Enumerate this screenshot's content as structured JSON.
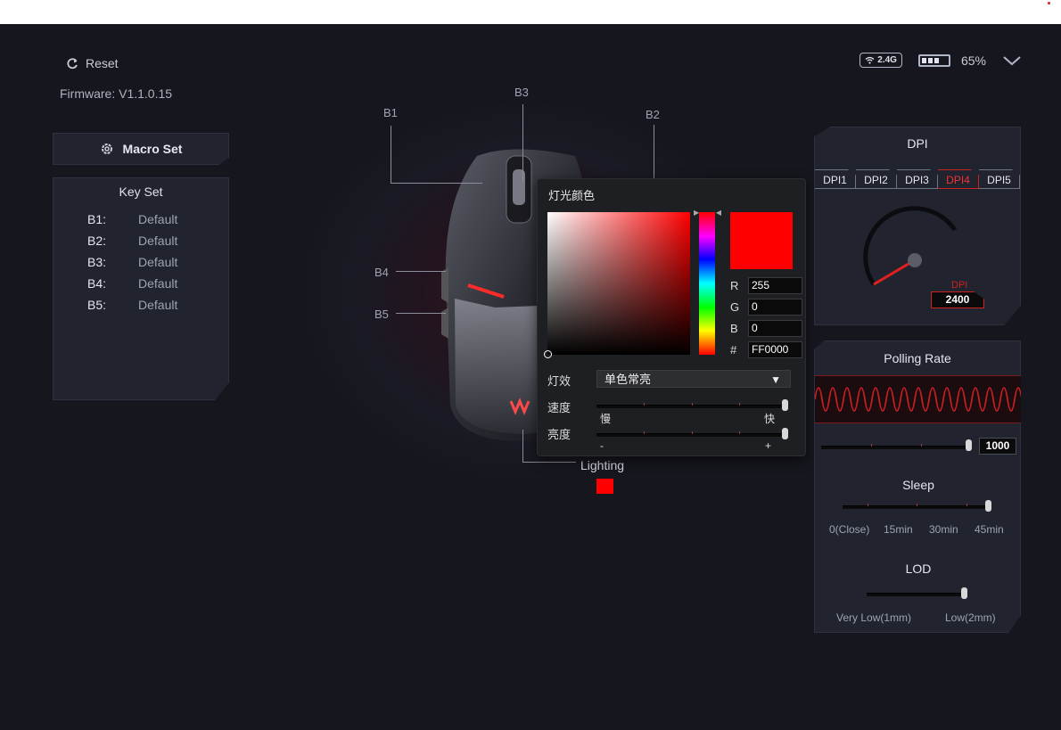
{
  "header": {
    "reset_label": "Reset",
    "firmware": "Firmware: V1.1.0.15",
    "connection": "2.4G",
    "battery_pct": "65%",
    "battery_level": 0.65
  },
  "left": {
    "macro_label": "Macro Set",
    "keyset_title": "Key Set",
    "keys": [
      {
        "key": "B1:",
        "value": "Default"
      },
      {
        "key": "B2:",
        "value": "Default"
      },
      {
        "key": "B3:",
        "value": "Default"
      },
      {
        "key": "B4:",
        "value": "Default"
      },
      {
        "key": "B5:",
        "value": "Default"
      }
    ]
  },
  "mouse": {
    "labels": {
      "b1": "B1",
      "b2": "B2",
      "b3": "B3",
      "b4": "B4",
      "b5": "B5",
      "lighting": "Lighting"
    },
    "lighting_color": "#FF0000"
  },
  "picker": {
    "title": "灯光颜色",
    "r_label": "R",
    "r": "255",
    "g_label": "G",
    "g": "0",
    "b_label": "B",
    "b": "0",
    "hex_label": "#",
    "hex": "FF0000",
    "effect_label": "灯效",
    "effect_value": "单色常亮",
    "speed_label": "速度",
    "speed_min": "慢",
    "speed_max": "快",
    "speed_level": 1.0,
    "brightness_label": "亮度",
    "brightness_min": "-",
    "brightness_max": "+",
    "brightness_level": 1.0
  },
  "dpi": {
    "title": "DPI",
    "tabs": [
      "DPI1",
      "DPI2",
      "DPI3",
      "DPI4",
      "DPI5"
    ],
    "selected": "DPI4",
    "gauge_label": "DPI",
    "value": "2400"
  },
  "polling": {
    "title": "Polling Rate",
    "value": "1000",
    "level": 1.0
  },
  "sleep": {
    "title": "Sleep",
    "options": [
      "0(Close)",
      "15min",
      "30min",
      "45min"
    ],
    "selected": "45min"
  },
  "lod": {
    "title": "LOD",
    "options": [
      "Very Low(1mm)",
      "Low(2mm)"
    ],
    "selected": "Low(2mm)"
  },
  "colors": {
    "accent": "#E02020",
    "panel": "#21232F",
    "background": "#16161E"
  }
}
